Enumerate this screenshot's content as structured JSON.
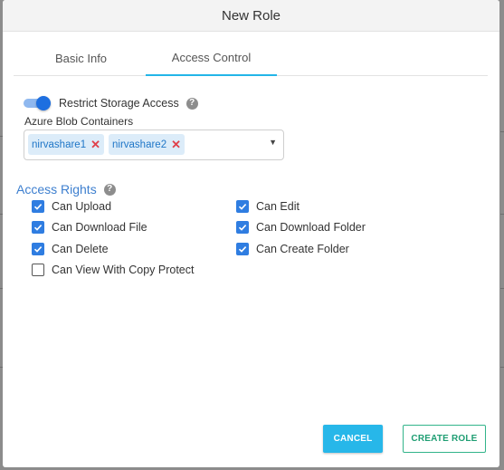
{
  "dialog": {
    "title": "New Role",
    "tabs": [
      {
        "label": "Basic Info",
        "active": false
      },
      {
        "label": "Access Control",
        "active": true
      }
    ],
    "restrict_storage": {
      "label": "Restrict Storage Access",
      "enabled": true
    },
    "containers": {
      "label": "Azure Blob Containers",
      "selected": [
        "nirvashare1",
        "nirvashare2"
      ]
    },
    "access_rights": {
      "title": "Access Rights",
      "items": [
        {
          "label": "Can Upload",
          "checked": true
        },
        {
          "label": "Can Edit",
          "checked": true
        },
        {
          "label": "Can Download File",
          "checked": true
        },
        {
          "label": "Can Download Folder",
          "checked": true
        },
        {
          "label": "Can Delete",
          "checked": true
        },
        {
          "label": "Can Create Folder",
          "checked": true
        },
        {
          "label": "Can View With Copy Protect",
          "checked": false
        }
      ]
    },
    "buttons": {
      "cancel": "CANCEL",
      "create": "CREATE ROLE"
    }
  },
  "colors": {
    "accent": "#23b5e8",
    "checkbox": "#2f7de1",
    "toggle": "#1e6fe0",
    "section_title": "#3d7fcf",
    "chip_bg": "#dcecf9",
    "chip_remove": "#e0404a",
    "create_button": "#1f9e73"
  },
  "icons": [
    "help-icon",
    "remove-icon",
    "chevron-down-icon",
    "check-icon"
  ]
}
